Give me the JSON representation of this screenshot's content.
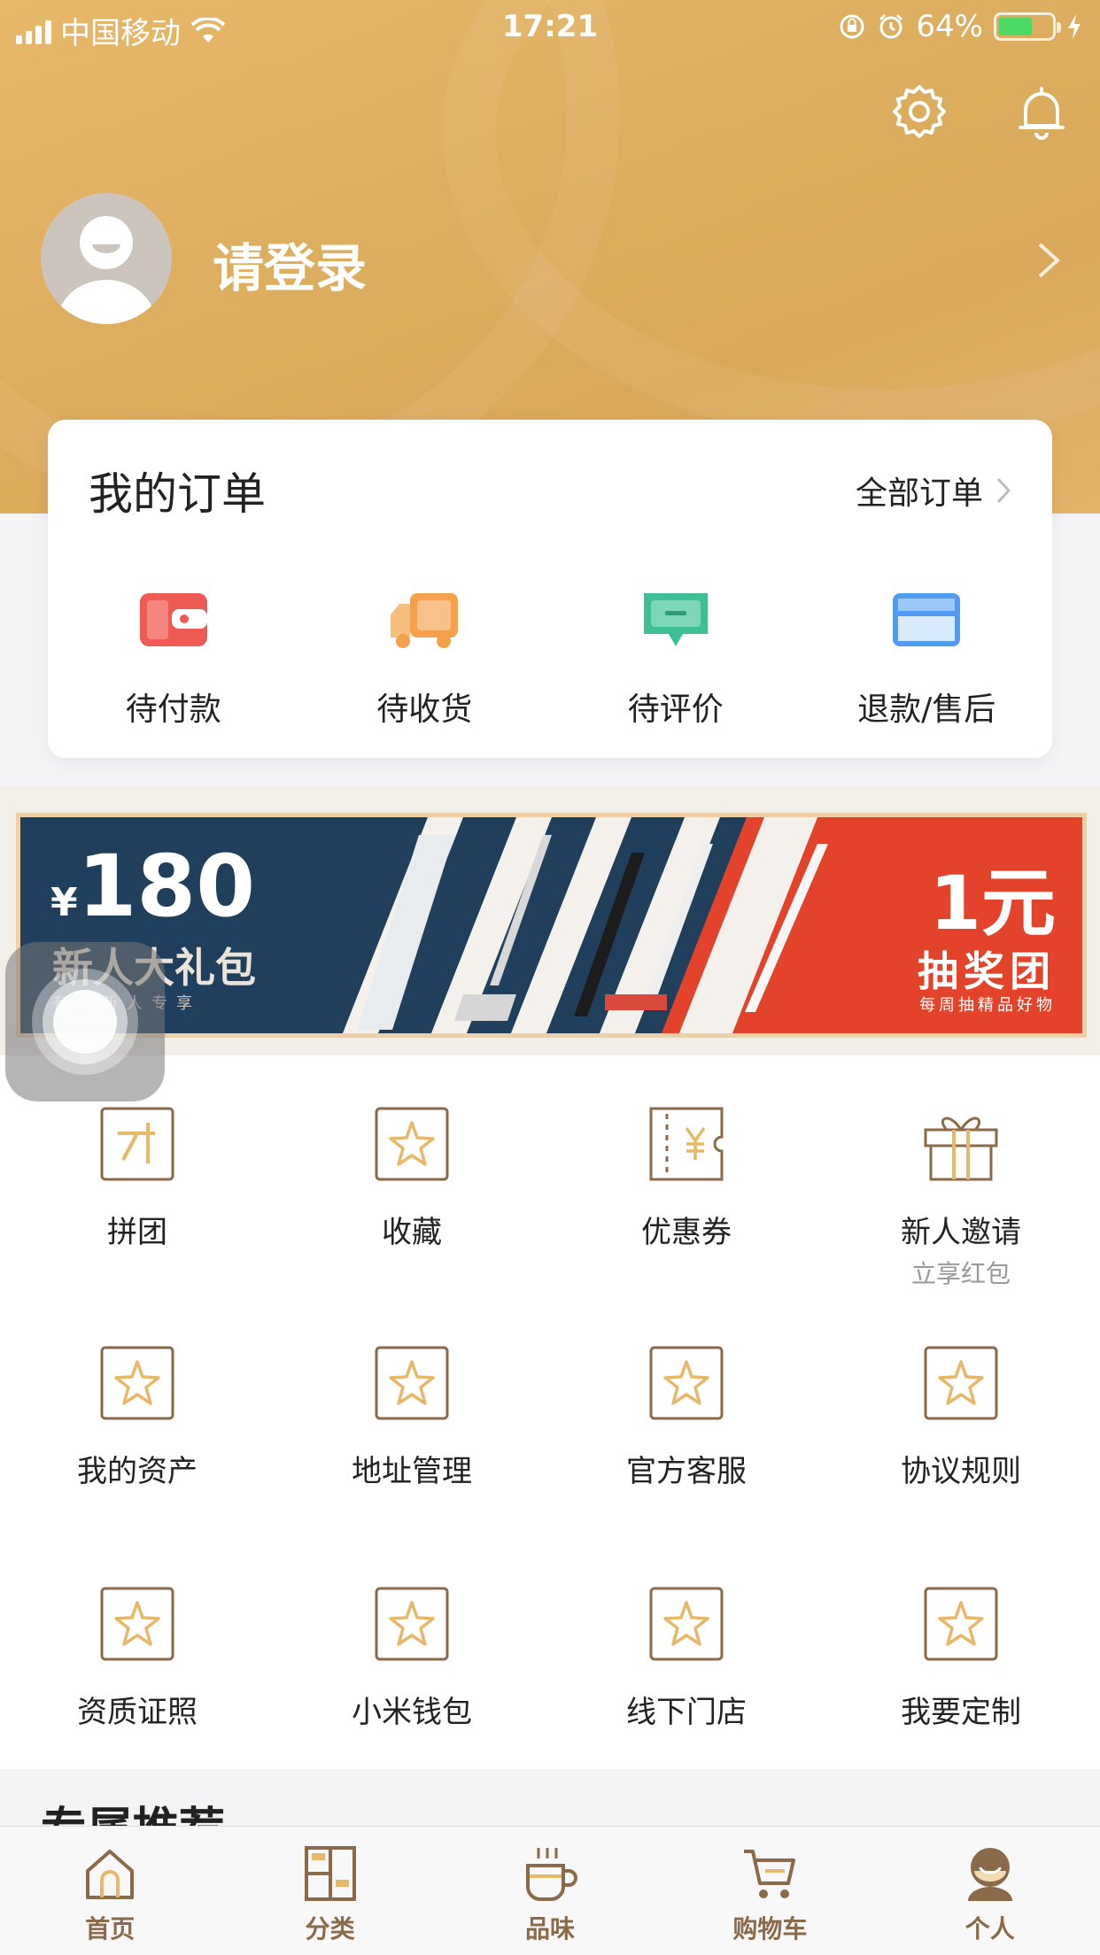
{
  "status_bar": {
    "carrier": "中国移动",
    "time": "17:21",
    "battery_percent_label": "64%",
    "battery_level": 0.64,
    "icons": [
      "signal-icon",
      "wifi-icon",
      "orientation-lock-icon",
      "alarm-icon",
      "battery-icon",
      "charging-icon"
    ]
  },
  "header": {
    "login_label": "请登录",
    "icons": [
      "settings-icon",
      "bell-icon",
      "avatar-icon",
      "chevron-right-icon"
    ]
  },
  "orders": {
    "title": "我的订单",
    "all_label": "全部订单",
    "items": [
      {
        "label": "待付款",
        "icon": "wallet-icon",
        "color": "#ef5a54"
      },
      {
        "label": "待收货",
        "icon": "truck-icon",
        "color": "#f5a04a"
      },
      {
        "label": "待评价",
        "icon": "comment-icon",
        "color": "#3fbf95"
      },
      {
        "label": "退款/售后",
        "icon": "card-icon",
        "color": "#4f9cf2"
      }
    ]
  },
  "banner": {
    "currency": "¥",
    "amount": "180",
    "pack_label": "新人大礼包",
    "pack_sub": "有品新人专享",
    "lottery_price": "1元",
    "lottery_label": "抽奖团",
    "lottery_sub": "每周抽精品好物",
    "colors": {
      "navy": "#1f3f5d",
      "red": "#e2432a",
      "border": "#f1cfa5"
    }
  },
  "grid": {
    "items": [
      {
        "label": "拼团",
        "icon": "group-buy-icon"
      },
      {
        "label": "收藏",
        "icon": "star-icon"
      },
      {
        "label": "优惠券",
        "icon": "coupon-icon"
      },
      {
        "label": "新人邀请",
        "sub": "立享红包",
        "icon": "gift-icon"
      },
      {
        "label": "我的资产",
        "icon": "star-icon"
      },
      {
        "label": "地址管理",
        "icon": "star-icon"
      },
      {
        "label": "官方客服",
        "icon": "star-icon"
      },
      {
        "label": "协议规则",
        "icon": "star-icon"
      },
      {
        "label": "资质证照",
        "icon": "star-icon"
      },
      {
        "label": "小米钱包",
        "icon": "star-icon"
      },
      {
        "label": "线下门店",
        "icon": "star-icon"
      },
      {
        "label": "我要定制",
        "icon": "star-icon"
      }
    ],
    "icon_color": "#8a6a48",
    "accent_color": "#e8b86a"
  },
  "section_peek": {
    "title": "专属推荐"
  },
  "tabbar": {
    "tabs": [
      {
        "label": "首页",
        "icon": "home-icon"
      },
      {
        "label": "分类",
        "icon": "category-icon"
      },
      {
        "label": "品味",
        "icon": "cup-icon"
      },
      {
        "label": "购物车",
        "icon": "cart-icon"
      },
      {
        "label": "个人",
        "icon": "profile-icon"
      }
    ],
    "active": "个人",
    "color": "#8a6a48"
  }
}
